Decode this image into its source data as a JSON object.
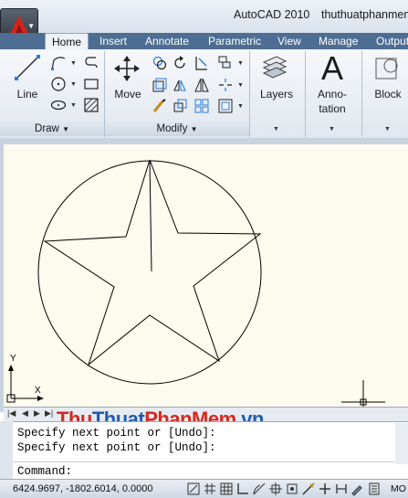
{
  "title": {
    "app_name": "AutoCAD 2010",
    "document_name": "thuthuatphanmem"
  },
  "tabs": [
    {
      "label": "Home",
      "active": true
    },
    {
      "label": "Insert"
    },
    {
      "label": "Annotate"
    },
    {
      "label": "Parametric"
    },
    {
      "label": "View"
    },
    {
      "label": "Manage"
    },
    {
      "label": "Output"
    }
  ],
  "ribbon": {
    "draw": {
      "panel_label": "Draw",
      "line_label": "Line"
    },
    "modify": {
      "panel_label": "Modify",
      "move_label": "Move"
    },
    "layers_label": "Layers",
    "annotation_label": "Anno-\ntation",
    "annotation_line1": "Anno-",
    "annotation_line2": "tation",
    "annotation_glyph": "A",
    "block_label": "Block"
  },
  "canvas": {
    "background": "#fcfbed",
    "ucs_y_label": "Y",
    "ucs_x_label": "X"
  },
  "watermark": {
    "part1": "Thu",
    "part2": "Thuat",
    "part3": "PhanMem",
    "part4": ".vn"
  },
  "command": {
    "history": [
      "Specify next point or [Undo]:",
      "Specify next point or [Undo]:"
    ],
    "prompt": "Command:"
  },
  "status": {
    "coordinates": "6424.9697, -1802.6014, 0.0000",
    "model_label": "MO"
  },
  "colors": {
    "tab_strip": "#4d6d92",
    "canvas_background": "#fcfbed",
    "watermark_red": "#d7281e",
    "watermark_blue": "#1f5bb3"
  }
}
